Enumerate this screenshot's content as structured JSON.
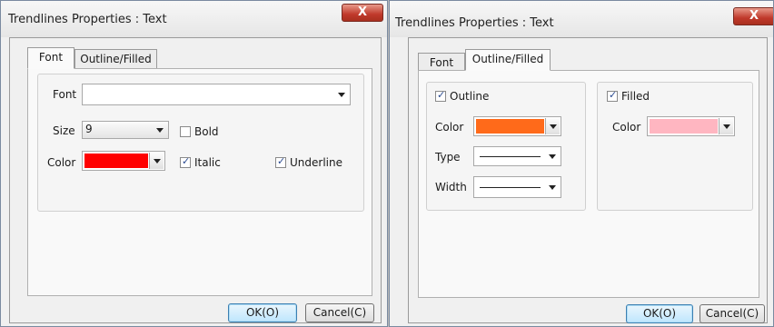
{
  "dialog_left": {
    "title": "Trendlines Properties : Text",
    "close_label": "X",
    "tabs": [
      {
        "label": "Font",
        "selected": true
      },
      {
        "label": "Outline/Filled",
        "selected": false
      }
    ],
    "font_label": "Font",
    "font_value": "",
    "size_label": "Size",
    "size_value": "9",
    "bold_label": "Bold",
    "bold_checked": false,
    "color_label": "Color",
    "color_value": "#ff0000",
    "italic_label": "Italic",
    "italic_checked": true,
    "underline_label": "Underline",
    "underline_checked": true,
    "ok_label": "OK(O)",
    "cancel_label": "Cancel(C)"
  },
  "dialog_right": {
    "title": "Trendlines Properties : Text",
    "close_label": "X",
    "tabs": [
      {
        "label": "Font",
        "selected": false
      },
      {
        "label": "Outline/Filled",
        "selected": true
      }
    ],
    "outline_label": "Outline",
    "outline_checked": true,
    "outline_color_label": "Color",
    "outline_color_value": "#ff6a1a",
    "type_label": "Type",
    "width_label": "Width",
    "filled_label": "Filled",
    "filled_checked": true,
    "filled_color_label": "Color",
    "filled_color_value": "#ffb6c1",
    "ok_label": "OK(O)",
    "cancel_label": "Cancel(C)"
  }
}
